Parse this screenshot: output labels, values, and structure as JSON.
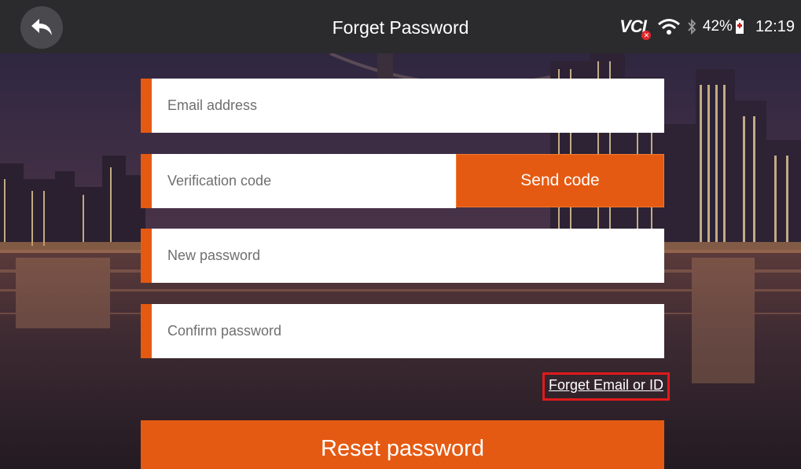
{
  "header": {
    "title": "Forget Password",
    "back_icon": "back-arrow-icon"
  },
  "status_bar": {
    "vci_label": "VCI",
    "vci_status_icon": "vci-disconnected-icon",
    "wifi_icon": "wifi-icon",
    "bluetooth_icon": "bluetooth-icon",
    "battery_percent": "42%",
    "battery_icon": "battery-icon",
    "time": "12:19"
  },
  "form": {
    "email_placeholder": "Email address",
    "code_placeholder": "Verification code",
    "send_code_label": "Send code",
    "new_password_placeholder": "New password",
    "confirm_password_placeholder": "Confirm password",
    "forget_link": "Forget Email or ID",
    "reset_button": "Reset password"
  },
  "colors": {
    "accent": "#e55a12",
    "topbar": "#2b2b2e",
    "highlight_border": "#e01b1b"
  }
}
